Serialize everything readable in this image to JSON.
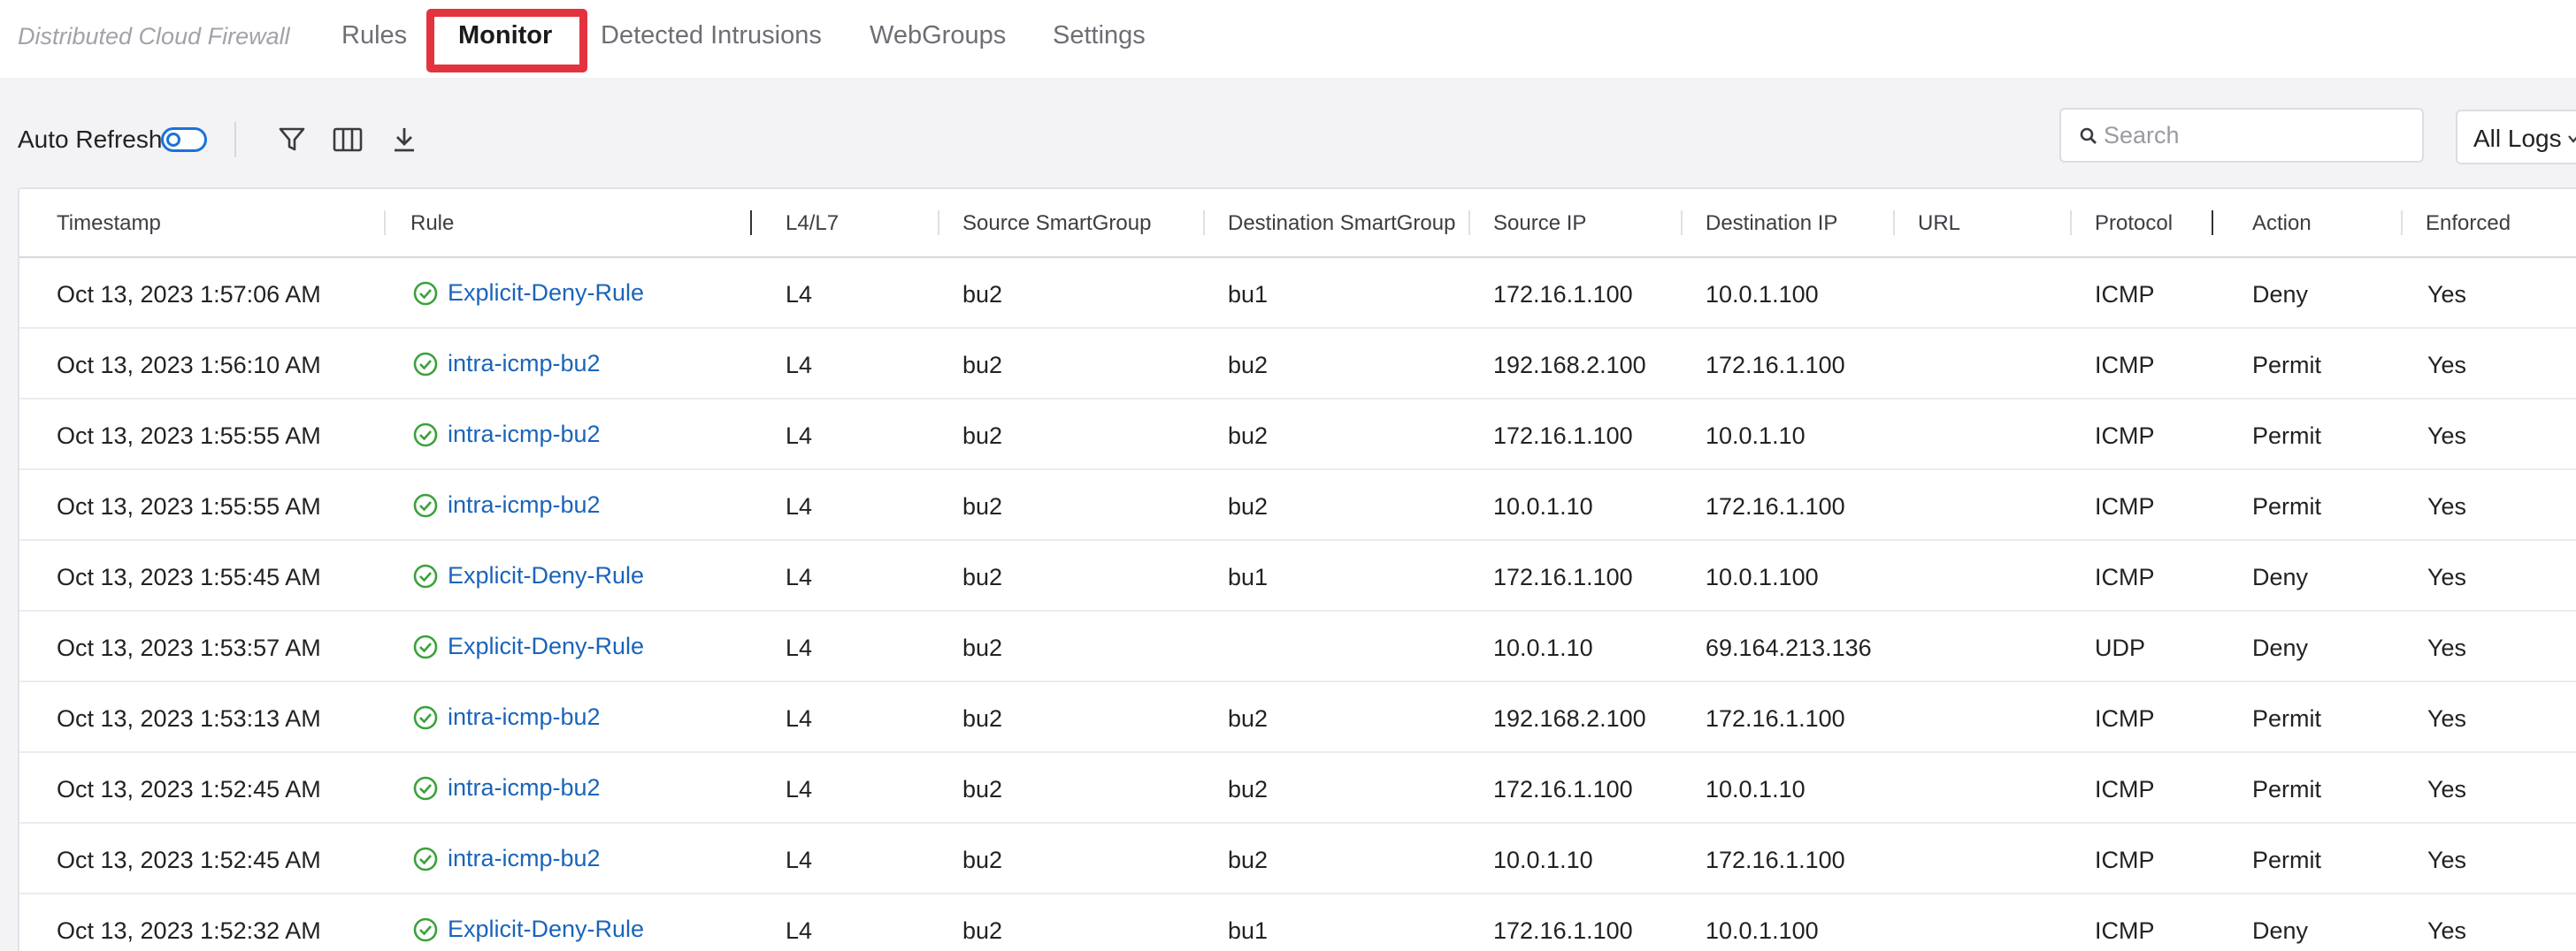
{
  "app": {
    "title": "Distributed Cloud Firewall",
    "tabs": [
      {
        "label": "Rules"
      },
      {
        "label": "Monitor",
        "active": true
      },
      {
        "label": "Detected Intrusions"
      },
      {
        "label": "WebGroups"
      },
      {
        "label": "Settings"
      }
    ],
    "highlight_color": "#e3333f"
  },
  "toolbar": {
    "auto_refresh_label": "Auto Refresh",
    "auto_refresh_on": false,
    "icons": [
      "filter-icon",
      "columns-icon",
      "download-icon"
    ],
    "search_placeholder": "Search",
    "log_filter": "All Logs"
  },
  "table": {
    "columns": [
      "Timestamp",
      "Rule",
      "L4/L7",
      "Source SmartGroup",
      "Destination SmartGroup",
      "Source IP",
      "Destination IP",
      "URL",
      "Protocol",
      "Action",
      "Enforced"
    ],
    "rows": [
      {
        "timestamp": "Oct 13, 2023 1:57:06 AM",
        "rule": "Explicit-Deny-Rule",
        "layer": "L4",
        "src_group": "bu2",
        "dst_group": "bu1",
        "src_ip": "172.16.1.100",
        "dst_ip": "10.0.1.100",
        "url": "",
        "protocol": "ICMP",
        "action": "Deny",
        "enforced": "Yes"
      },
      {
        "timestamp": "Oct 13, 2023 1:56:10 AM",
        "rule": "intra-icmp-bu2",
        "layer": "L4",
        "src_group": "bu2",
        "dst_group": "bu2",
        "src_ip": "192.168.2.100",
        "dst_ip": "172.16.1.100",
        "url": "",
        "protocol": "ICMP",
        "action": "Permit",
        "enforced": "Yes"
      },
      {
        "timestamp": "Oct 13, 2023 1:55:55 AM",
        "rule": "intra-icmp-bu2",
        "layer": "L4",
        "src_group": "bu2",
        "dst_group": "bu2",
        "src_ip": "172.16.1.100",
        "dst_ip": "10.0.1.10",
        "url": "",
        "protocol": "ICMP",
        "action": "Permit",
        "enforced": "Yes"
      },
      {
        "timestamp": "Oct 13, 2023 1:55:55 AM",
        "rule": "intra-icmp-bu2",
        "layer": "L4",
        "src_group": "bu2",
        "dst_group": "bu2",
        "src_ip": "10.0.1.10",
        "dst_ip": "172.16.1.100",
        "url": "",
        "protocol": "ICMP",
        "action": "Permit",
        "enforced": "Yes"
      },
      {
        "timestamp": "Oct 13, 2023 1:55:45 AM",
        "rule": "Explicit-Deny-Rule",
        "layer": "L4",
        "src_group": "bu2",
        "dst_group": "bu1",
        "src_ip": "172.16.1.100",
        "dst_ip": "10.0.1.100",
        "url": "",
        "protocol": "ICMP",
        "action": "Deny",
        "enforced": "Yes"
      },
      {
        "timestamp": "Oct 13, 2023 1:53:57 AM",
        "rule": "Explicit-Deny-Rule",
        "layer": "L4",
        "src_group": "bu2",
        "dst_group": "",
        "src_ip": "10.0.1.10",
        "dst_ip": "69.164.213.136",
        "url": "",
        "protocol": "UDP",
        "action": "Deny",
        "enforced": "Yes"
      },
      {
        "timestamp": "Oct 13, 2023 1:53:13 AM",
        "rule": "intra-icmp-bu2",
        "layer": "L4",
        "src_group": "bu2",
        "dst_group": "bu2",
        "src_ip": "192.168.2.100",
        "dst_ip": "172.16.1.100",
        "url": "",
        "protocol": "ICMP",
        "action": "Permit",
        "enforced": "Yes"
      },
      {
        "timestamp": "Oct 13, 2023 1:52:45 AM",
        "rule": "intra-icmp-bu2",
        "layer": "L4",
        "src_group": "bu2",
        "dst_group": "bu2",
        "src_ip": "172.16.1.100",
        "dst_ip": "10.0.1.10",
        "url": "",
        "protocol": "ICMP",
        "action": "Permit",
        "enforced": "Yes"
      },
      {
        "timestamp": "Oct 13, 2023 1:52:45 AM",
        "rule": "intra-icmp-bu2",
        "layer": "L4",
        "src_group": "bu2",
        "dst_group": "bu2",
        "src_ip": "10.0.1.10",
        "dst_ip": "172.16.1.100",
        "url": "",
        "protocol": "ICMP",
        "action": "Permit",
        "enforced": "Yes"
      },
      {
        "timestamp": "Oct 13, 2023 1:52:32 AM",
        "rule": "Explicit-Deny-Rule",
        "layer": "L4",
        "src_group": "bu2",
        "dst_group": "bu1",
        "src_ip": "172.16.1.100",
        "dst_ip": "10.0.1.100",
        "url": "",
        "protocol": "ICMP",
        "action": "Deny",
        "enforced": "Yes"
      }
    ]
  },
  "colors": {
    "accent": "#1a73d9",
    "link": "#1a64ba",
    "status_check": "#3aa13a"
  }
}
